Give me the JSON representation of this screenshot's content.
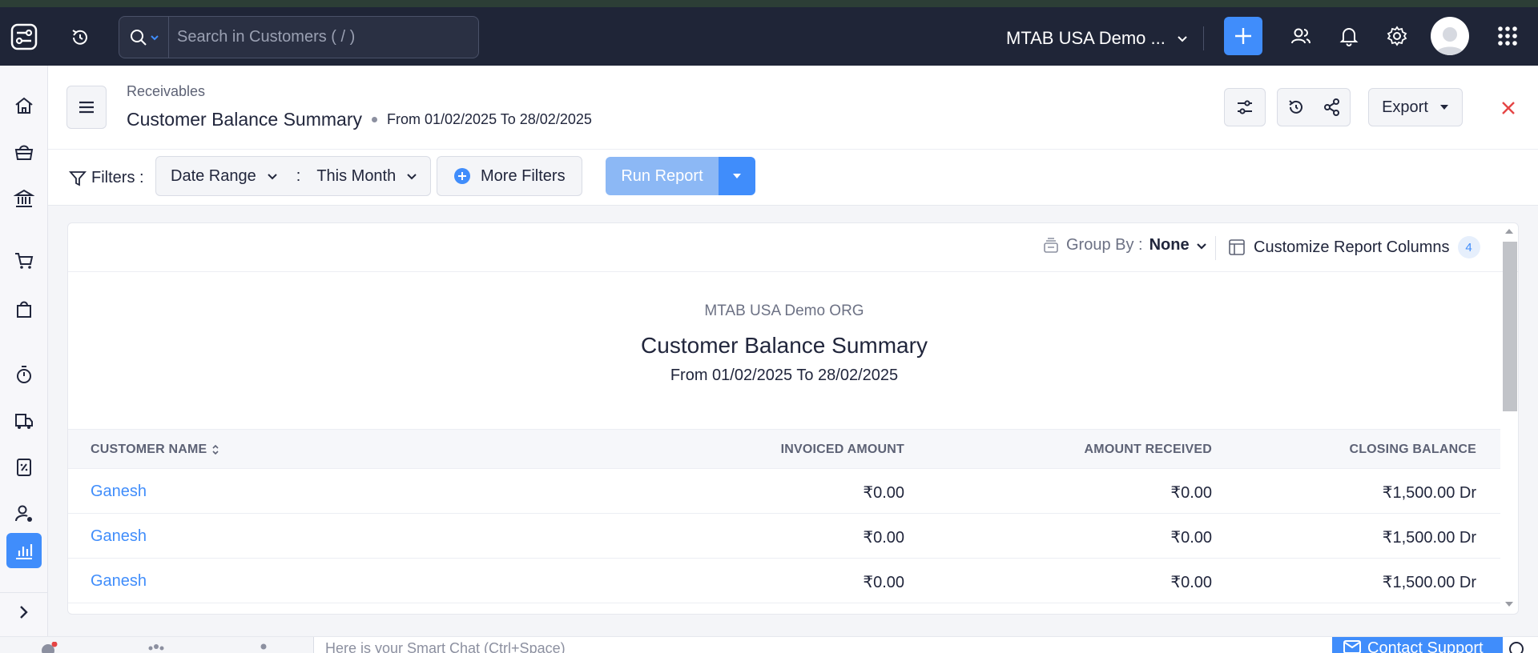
{
  "topbar": {
    "search_placeholder": "Search in Customers ( / )",
    "org_name": "MTAB USA Demo ...",
    "icons": [
      "app-logo-icon",
      "recent-history-icon",
      "search-icon",
      "add-icon",
      "users-icon",
      "notification-bell-icon",
      "settings-gear-icon",
      "apps-grid-icon"
    ],
    "accent": "#408dfb"
  },
  "sidebar": {
    "items": [
      {
        "icon": "home-icon"
      },
      {
        "icon": "items-basket-icon"
      },
      {
        "icon": "banking-icon"
      },
      {
        "icon": "sales-cart-icon"
      },
      {
        "icon": "purchases-bag-icon"
      },
      {
        "icon": "time-tracking-icon"
      },
      {
        "icon": "e-way-bill-icon"
      },
      {
        "icon": "tax-icon"
      },
      {
        "icon": "accountant-icon"
      },
      {
        "icon": "reports-chart-icon",
        "active": true
      }
    ]
  },
  "header": {
    "breadcrumb": "Receivables",
    "title": "Customer Balance Summary",
    "range": "From 01/02/2025 To 28/02/2025",
    "export_label": "Export"
  },
  "filters": {
    "label": "Filters :",
    "date_range_label": "Date Range",
    "separator": ":",
    "date_range_value": "This Month",
    "more_filters": "More Filters",
    "run_report": "Run Report"
  },
  "report": {
    "group_by_label": "Group By :",
    "group_by_value": "None",
    "customize_label": "Customize Report Columns",
    "customize_count": "4",
    "org_name": "MTAB USA Demo ORG",
    "title": "Customer Balance Summary",
    "range": "From 01/02/2025 To 28/02/2025",
    "columns": [
      "CUSTOMER NAME",
      "INVOICED AMOUNT",
      "AMOUNT RECEIVED",
      "CLOSING BALANCE"
    ],
    "rows": [
      {
        "customer": "Ganesh",
        "invoiced": "₹0.00",
        "received": "₹0.00",
        "closing": "₹1,500.00 Dr"
      },
      {
        "customer": "Ganesh",
        "invoiced": "₹0.00",
        "received": "₹0.00",
        "closing": "₹1,500.00 Dr"
      },
      {
        "customer": "Ganesh",
        "invoiced": "₹0.00",
        "received": "₹0.00",
        "closing": "₹1,500.00 Dr"
      }
    ]
  },
  "bottombar": {
    "smart_chat_placeholder": "Here is your Smart Chat (Ctrl+Space)",
    "contact_support": "Contact Support"
  }
}
